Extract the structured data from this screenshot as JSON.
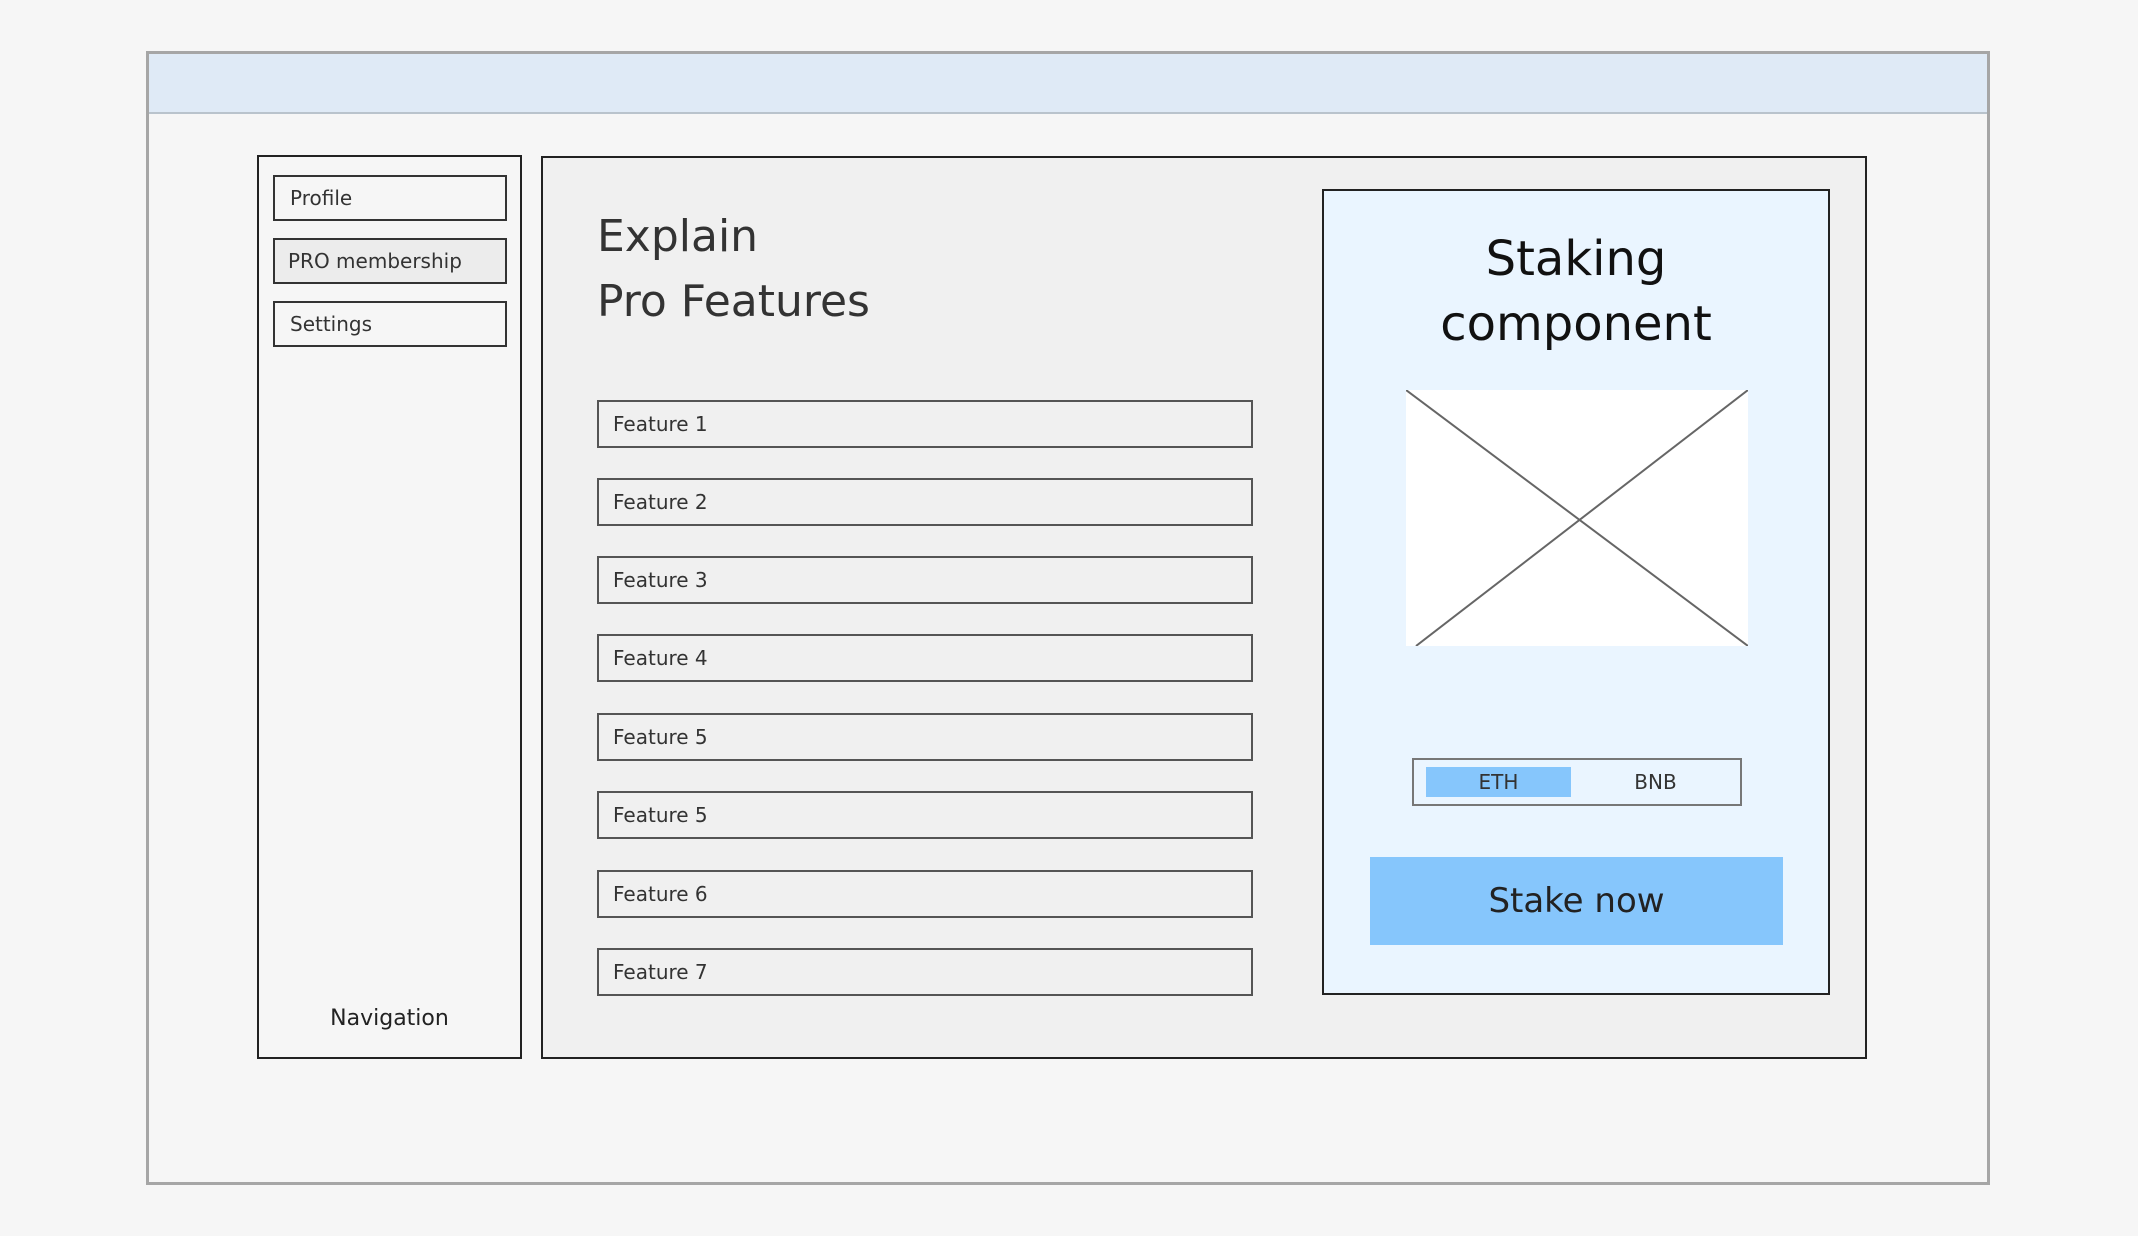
{
  "sidebar": {
    "items": [
      {
        "label": "Profile"
      },
      {
        "label": "PRO membership"
      },
      {
        "label": "Settings"
      }
    ],
    "active_item": "PRO membership",
    "caption": "Navigation"
  },
  "main": {
    "title_line1": "Explain",
    "title_line2": "Pro Features",
    "features": [
      {
        "label": "Feature 1"
      },
      {
        "label": "Feature 2"
      },
      {
        "label": "Feature 3"
      },
      {
        "label": "Feature 4"
      },
      {
        "label": "Feature 5"
      },
      {
        "label": "Feature 5"
      },
      {
        "label": "Feature 6"
      },
      {
        "label": "Feature 7"
      }
    ]
  },
  "staking": {
    "title_line1": "Staking",
    "title_line2": "component",
    "tokens": [
      {
        "label": "ETH"
      },
      {
        "label": "BNB"
      }
    ],
    "selected_token": "ETH",
    "button_label": "Stake now"
  },
  "colors": {
    "titlebar": "#dfeaf6",
    "accent": "#86c6fc",
    "card_background": "#eaf5ff",
    "panel_background": "#f0f0f0",
    "page_background": "#f6f6f6"
  }
}
